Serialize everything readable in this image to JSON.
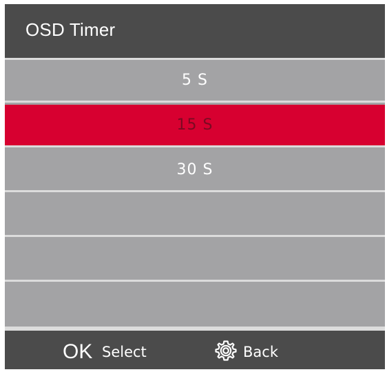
{
  "osd": {
    "title": "OSD Timer"
  },
  "options": [
    {
      "label": "5 S",
      "selected": false
    },
    {
      "label": "15 S",
      "selected": true
    },
    {
      "label": "30 S",
      "selected": false
    },
    {
      "label": "",
      "selected": false
    },
    {
      "label": "",
      "selected": false
    },
    {
      "label": "",
      "selected": false
    }
  ],
  "footer": {
    "ok_glyph": "OK",
    "select_label": "Select",
    "back_label": "Back",
    "back_icon": "gear-icon"
  },
  "colors": {
    "header_bg": "#4b4b4b",
    "row_bg": "#a3a3a5",
    "selected_bg": "#d70030",
    "divider": "#dcdcdc"
  }
}
